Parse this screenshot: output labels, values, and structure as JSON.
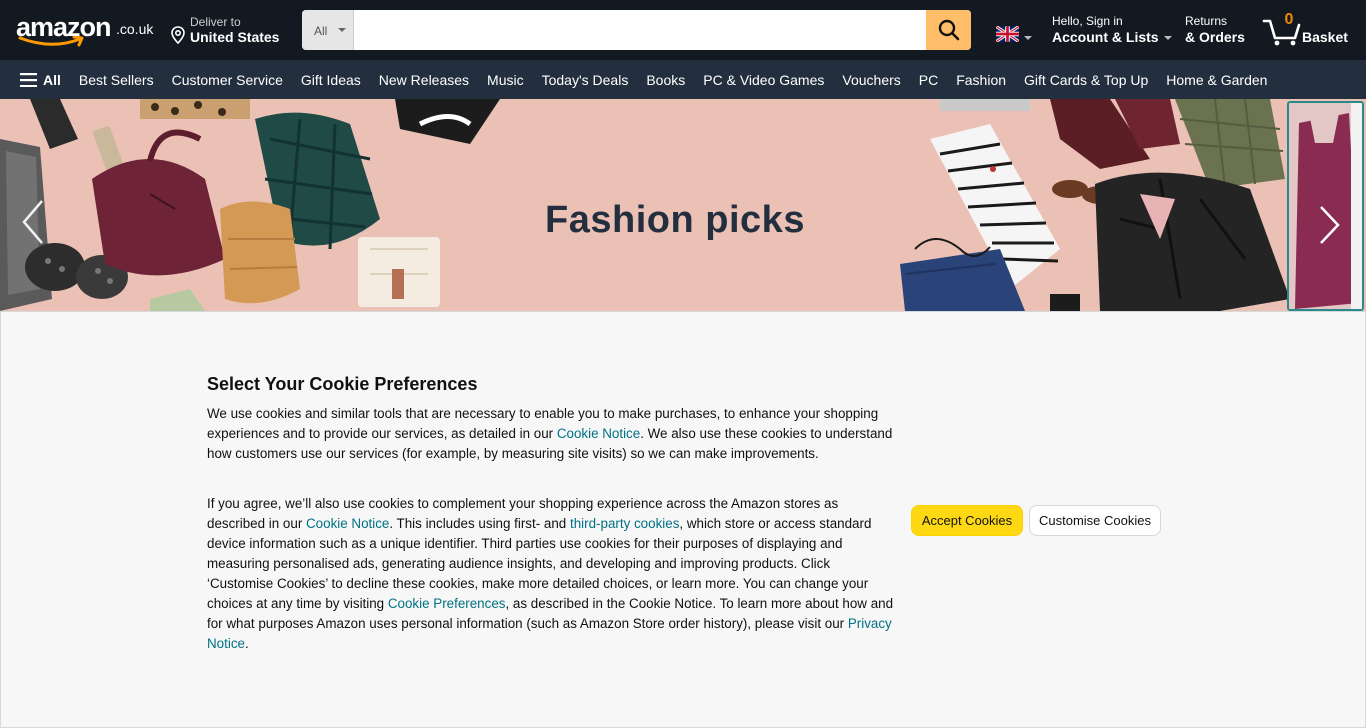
{
  "header": {
    "logo_text": "amazon",
    "logo_tld": ".co.uk",
    "deliver_line1": "Deliver to",
    "deliver_line2": "United States",
    "search": {
      "category": "All",
      "placeholder": "",
      "value": ""
    },
    "language_flag": "uk-flag-icon",
    "account_line1": "Hello, Sign in",
    "account_line2": "Account & Lists",
    "orders_line1": "Returns",
    "orders_line2": "& Orders",
    "basket_count": "0",
    "basket_label": "Basket"
  },
  "subnav": {
    "all_label": "All",
    "items": [
      "Best Sellers",
      "Customer Service",
      "Gift Ideas",
      "New Releases",
      "Music",
      "Today's Deals",
      "Books",
      "PC & Video Games",
      "Vouchers",
      "PC",
      "Fashion",
      "Gift Cards & Top Up",
      "Home & Garden"
    ]
  },
  "hero": {
    "title": "Fashion picks"
  },
  "cookie": {
    "title": "Select Your Cookie Preferences",
    "p1_a": "We use cookies and similar tools that are necessary to enable you to make purchases, to enhance your shopping experiences and to provide our services, as detailed in our ",
    "p1_link1": "Cookie Notice",
    "p1_b": ". We also use these cookies to understand how customers use our services (for example, by measuring site visits) so we can make improvements.",
    "p2_a": "If you agree, we’ll also use cookies to complement your shopping experience across the Amazon stores as described in our ",
    "p2_link1": "Cookie Notice",
    "p2_b": ". This includes using first- and ",
    "p2_link2": "third-party cookies",
    "p2_c": ", which store or access standard device information such as a unique identifier. Third parties use cookies for their purposes of displaying and measuring personalised ads, generating audience insights, and developing and improving products. Click ‘Customise Cookies’ to decline these cookies, make more detailed choices, or learn more. You can change your choices at any time by visiting ",
    "p2_link3": "Cookie Preferences",
    "p2_d": ", as described in the Cookie Notice. To learn more about how and for what purposes Amazon uses personal information (such as Amazon Store order history), please visit our ",
    "p2_link4": "Privacy Notice",
    "p2_e": ".",
    "accept_label": "Accept Cookies",
    "customise_label": "Customise Cookies"
  },
  "colors": {
    "header_bg": "#131921",
    "subnav_bg": "#232f3e",
    "search_button": "#febd69",
    "accept_button": "#ffd814",
    "link": "#007185",
    "hero_bg": "#ebc1b6",
    "basket_count": "#f08804"
  }
}
